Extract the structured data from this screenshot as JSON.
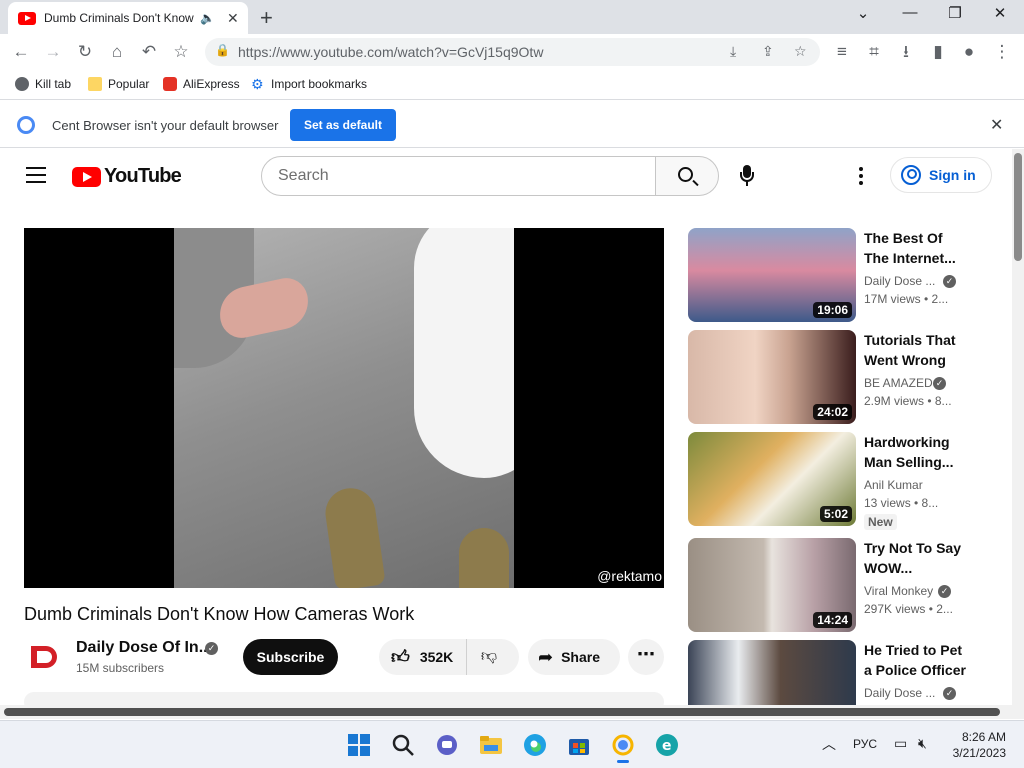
{
  "browser": {
    "tab_title": "Dumb Criminals Don't Know How Cameras Work",
    "url": "https://www.youtube.com/watch?v=GcVj15q9Otw",
    "bookmarks": [
      "Kill tab",
      "Popular",
      "AliExpress",
      "Import bookmarks"
    ],
    "infobar_message": "Cent Browser isn't your default browser",
    "infobar_button": "Set as default"
  },
  "youtube": {
    "logo_text": "YouTube",
    "search_placeholder": "Search",
    "signin_label": "Sign in",
    "video": {
      "title": "Dumb Criminals Don't Know How Cameras Work",
      "watermark": "@rektamo",
      "channel": "Daily Dose Of In...",
      "subscribers": "15M subscribers",
      "subscribe_label": "Subscribe",
      "likes": "352K",
      "share_label": "Share"
    },
    "recommended": [
      {
        "title": "The Best Of The Internet...",
        "channel": "Daily Dose ...",
        "verified": true,
        "views": "17M views • 2...",
        "duration": "19:06",
        "new": false
      },
      {
        "title": "Tutorials That Went Wrong -...",
        "channel": "BE AMAZED",
        "verified": true,
        "views": "2.9M views • 8...",
        "duration": "24:02",
        "new": false
      },
      {
        "title": "Hardworking Man Selling...",
        "channel": "Anil Kumar",
        "verified": false,
        "views": "13 views • 8...",
        "duration": "5:02",
        "new": true,
        "new_label": "New"
      },
      {
        "title": "Try Not To Say WOW...",
        "channel": "Viral Monkey",
        "verified": true,
        "views": "297K views • 2...",
        "duration": "14:24",
        "new": false
      },
      {
        "title": "He Tried to Pet a Police Officer",
        "channel": "Daily Dose ...",
        "verified": true,
        "views": "",
        "duration": "",
        "new": false
      }
    ]
  },
  "taskbar": {
    "language": "РУС",
    "time": "8:26 AM",
    "date": "3/21/2023"
  },
  "colors": {
    "youtube_red": "#ff0000",
    "link_blue": "#065fd4",
    "button_blue": "#1a73e8"
  }
}
